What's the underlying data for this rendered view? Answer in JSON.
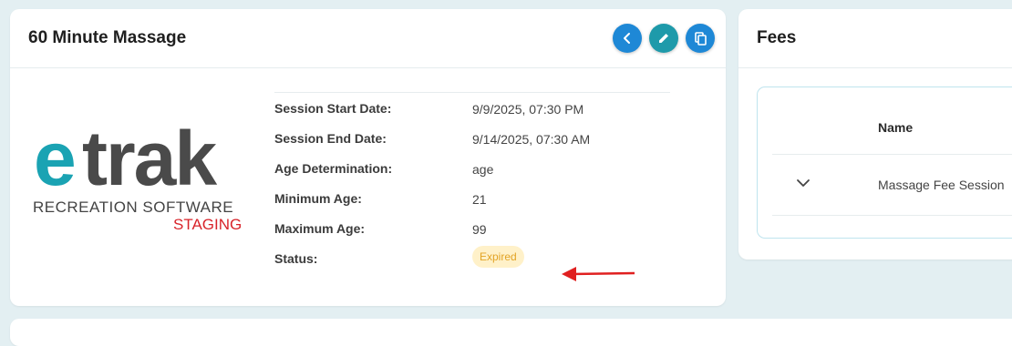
{
  "session": {
    "title": "60 Minute Massage",
    "details": [
      {
        "label": "Session Start Date:",
        "value": "9/9/2025, 07:30 PM"
      },
      {
        "label": "Session End Date:",
        "value": "9/14/2025, 07:30 AM"
      },
      {
        "label": "Age Determination:",
        "value": "age"
      },
      {
        "label": "Minimum Age:",
        "value": "21"
      },
      {
        "label": "Maximum Age:",
        "value": "99"
      }
    ],
    "status_label": "Status:",
    "status_value": "Expired"
  },
  "logo": {
    "e": "e",
    "trak": "trak",
    "subtitle": "RECREATION SOFTWARE",
    "env": "STAGING"
  },
  "fees": {
    "title": "Fees",
    "column_name": "Name",
    "rows": [
      {
        "name": "Massage Fee Session"
      }
    ]
  },
  "icons": {
    "back": "chevron-left-icon",
    "edit": "pencil-icon",
    "copy": "copy-icon",
    "expand": "chevron-down-icon",
    "annotation": "red-arrow-icon"
  },
  "colors": {
    "accent_blue": "#1e88d6",
    "accent_teal": "#1e9aaa",
    "badge_bg": "#fff1c9",
    "badge_text": "#e2a325",
    "annotation_red": "#e02020"
  }
}
